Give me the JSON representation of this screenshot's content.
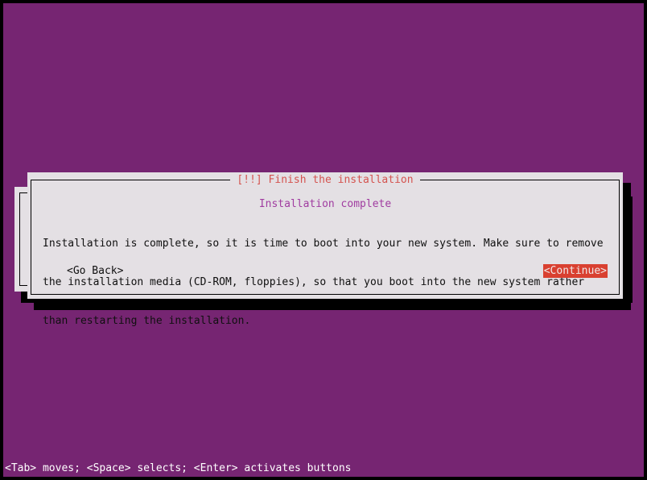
{
  "screen": {
    "background_color": "#762572",
    "frame_color": "#000000"
  },
  "dialog": {
    "title": "[!!] Finish the installation",
    "title_color": "#d4534f",
    "background_color": "#e4e0e4",
    "border_color": "#000000",
    "subtitle": "Installation complete",
    "subtitle_color": "#a03ca0",
    "body_lines": [
      "Installation is complete, so it is time to boot into your new system. Make sure to remove",
      "the installation media (CD-ROM, floppies), so that you boot into the new system rather",
      "than restarting the installation."
    ],
    "body_text_color": "#101010",
    "buttons": {
      "go_back": {
        "label": "<Go Back>",
        "selected": false,
        "text_color": "#101010"
      },
      "continue": {
        "label": "<Continue>",
        "selected": true,
        "text_color": "#f0e8e8",
        "highlight_color": "#d94030"
      }
    }
  },
  "statusbar": {
    "text": "<Tab> moves; <Space> selects; <Enter> activates buttons",
    "text_color": "#ffffff"
  }
}
